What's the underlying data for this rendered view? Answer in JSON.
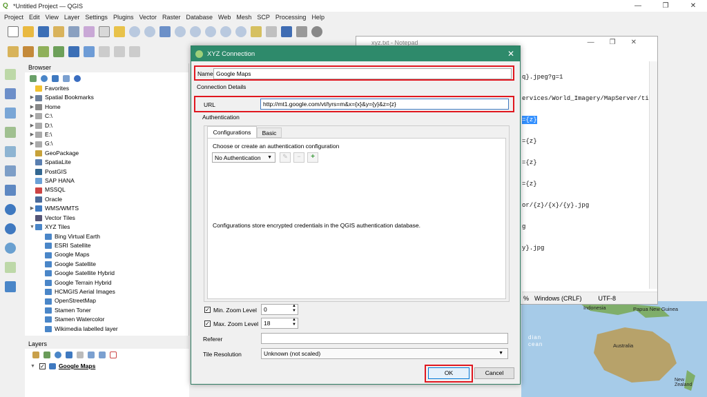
{
  "window": {
    "title": "*Untitled Project — QGIS",
    "min": "—",
    "max": "❐",
    "close": "✕"
  },
  "menu": [
    "Project",
    "Edit",
    "View",
    "Layer",
    "Settings",
    "Plugins",
    "Vector",
    "Raster",
    "Database",
    "Web",
    "Mesh",
    "SCP",
    "Processing",
    "Help"
  ],
  "browser": {
    "header": "Browser",
    "items": [
      {
        "label": "Favorites",
        "icon": "star-icon",
        "arrow": "",
        "indent": 0
      },
      {
        "label": "Spatial Bookmarks",
        "icon": "bookmark-icon",
        "arrow": "▶",
        "indent": 0
      },
      {
        "label": "Home",
        "icon": "home-folder-icon",
        "arrow": "▶",
        "indent": 0
      },
      {
        "label": "C:\\",
        "icon": "drive-icon",
        "arrow": "▶",
        "indent": 0
      },
      {
        "label": "D:\\",
        "icon": "drive-icon",
        "arrow": "▶",
        "indent": 0
      },
      {
        "label": "E:\\",
        "icon": "drive-icon",
        "arrow": "▶",
        "indent": 0
      },
      {
        "label": "G:\\",
        "icon": "drive-icon",
        "arrow": "▶",
        "indent": 0
      },
      {
        "label": "GeoPackage",
        "icon": "geopackage-icon",
        "arrow": "",
        "indent": 0
      },
      {
        "label": "SpatiaLite",
        "icon": "spatialite-icon",
        "arrow": "",
        "indent": 0
      },
      {
        "label": "PostGIS",
        "icon": "postgis-icon",
        "arrow": "",
        "indent": 0
      },
      {
        "label": "SAP HANA",
        "icon": "sap-hana-icon",
        "arrow": "",
        "indent": 0
      },
      {
        "label": "MSSQL",
        "icon": "mssql-icon",
        "arrow": "",
        "indent": 0
      },
      {
        "label": "Oracle",
        "icon": "oracle-icon",
        "arrow": "",
        "indent": 0
      },
      {
        "label": "WMS/WMTS",
        "icon": "wms-icon",
        "arrow": "▶",
        "indent": 0
      },
      {
        "label": "Vector Tiles",
        "icon": "vector-tiles-icon",
        "arrow": "",
        "indent": 0
      },
      {
        "label": "XYZ Tiles",
        "icon": "xyz-tiles-icon",
        "arrow": "▼",
        "indent": 0
      },
      {
        "label": "Bing Virtual Earth",
        "icon": "xyz-tiles-icon",
        "arrow": "",
        "indent": 1
      },
      {
        "label": "ESRI Satellite",
        "icon": "xyz-tiles-icon",
        "arrow": "",
        "indent": 1
      },
      {
        "label": "Google Maps",
        "icon": "xyz-tiles-icon",
        "arrow": "",
        "indent": 1
      },
      {
        "label": "Google Satellite",
        "icon": "xyz-tiles-icon",
        "arrow": "",
        "indent": 1
      },
      {
        "label": "Google Satellite Hybrid",
        "icon": "xyz-tiles-icon",
        "arrow": "",
        "indent": 1
      },
      {
        "label": "Google Terrain Hybrid",
        "icon": "xyz-tiles-icon",
        "arrow": "",
        "indent": 1
      },
      {
        "label": "HCMGIS Aerial Images",
        "icon": "xyz-tiles-icon",
        "arrow": "",
        "indent": 1
      },
      {
        "label": "OpenStreetMap",
        "icon": "xyz-tiles-icon",
        "arrow": "",
        "indent": 1
      },
      {
        "label": "Stamen Toner",
        "icon": "xyz-tiles-icon",
        "arrow": "",
        "indent": 1
      },
      {
        "label": "Stamen Watercolor",
        "icon": "xyz-tiles-icon",
        "arrow": "",
        "indent": 1
      },
      {
        "label": "Wikimedia labelled layer",
        "icon": "xyz-tiles-icon",
        "arrow": "",
        "indent": 1
      }
    ]
  },
  "layers": {
    "header": "Layers",
    "item": "Google Maps"
  },
  "notepad": {
    "title": "xyz.txt - Notepad",
    "lines": [
      "q}.jpeg?g=1",
      "ervices/World_Imagery/MapServer/ti",
      "={z}",
      "={z}",
      "={z}",
      "={z}",
      "or/{z}/{x}/{y}.jpg",
      "g",
      "y}.jpg"
    ],
    "status": {
      "zoom": "%",
      "eol": "Windows (CRLF)",
      "enc": "UTF-8"
    }
  },
  "map": {
    "labels": [
      "Indonesia",
      "Papua New Guinea",
      "dian",
      "cean",
      "Australia",
      "New Zealand"
    ]
  },
  "dialog": {
    "title": "XYZ Connection",
    "name_label": "Name",
    "name_value": "Google Maps",
    "details_label": "Connection Details",
    "url_label": "URL",
    "url_value": "http://mt1.google.com/vt/lyrs=m&x={x}&y={y}&z={z}",
    "auth_label": "Authentication",
    "tab_configs": "Configurations",
    "tab_basic": "Basic",
    "choose_text": "Choose or create an authentication configuration",
    "auth_select": "No Authentication",
    "auth_note": "Configurations store encrypted credentials in the QGIS authentication database.",
    "min_zoom_label": "Min. Zoom Level",
    "min_zoom": "0",
    "max_zoom_label": "Max. Zoom Level",
    "max_zoom": "18",
    "referer_label": "Referer",
    "referer_value": "",
    "tile_res_label": "Tile Resolution",
    "tile_res_value": "Unknown (not scaled)",
    "ok": "OK",
    "cancel": "Cancel"
  },
  "colors": {
    "dialog_title": "#2e8a6b",
    "highlight": "#e0161e",
    "sea": "#a6cbe8",
    "land": "#7fae6a"
  }
}
